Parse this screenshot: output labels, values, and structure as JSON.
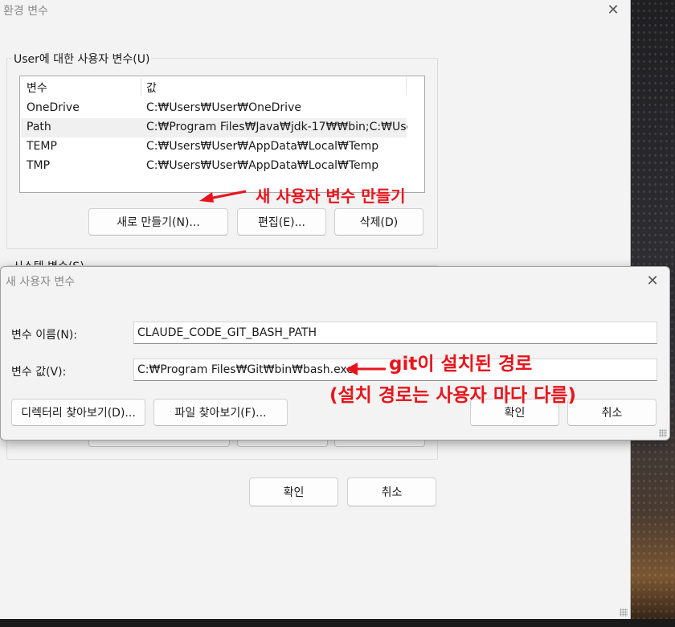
{
  "env_dialog": {
    "title": "환경 변수",
    "user_group_label": "User에 대한 사용자 변수(U)",
    "system_group_label": "시스템 변수(S)",
    "columns": [
      "변수",
      "값"
    ],
    "rows": [
      {
        "name": "OneDrive",
        "value": "C:₩Users₩User₩OneDrive"
      },
      {
        "name": "Path",
        "value": "C:₩Program Files₩Java₩jdk-17₩₩bin;C:₩Use..."
      },
      {
        "name": "TEMP",
        "value": "C:₩Users₩User₩AppData₩Local₩Temp"
      },
      {
        "name": "TMP",
        "value": "C:₩Users₩User₩AppData₩Local₩Temp"
      }
    ],
    "selected_row": 1,
    "buttons": {
      "new": "새로 만들기(N)...",
      "edit": "편집(E)...",
      "delete": "삭제(D)"
    },
    "footer_buttons": {
      "ok": "확인",
      "cancel": "취소"
    }
  },
  "new_var_dialog": {
    "title": "새 사용자 변수",
    "name_label": "변수 이름(N):",
    "name_value": "CLAUDE_CODE_GIT_BASH_PATH",
    "value_label": "변수 값(V):",
    "value_value": "C:₩Program Files₩Git₩bin₩bash.exe",
    "buttons": {
      "browse_dir": "디렉터리 찾아보기(D)...",
      "browse_file": "파일 찾아보기(F)...",
      "ok": "확인",
      "cancel": "취소"
    }
  },
  "annotations": {
    "new_var": "새 사용자 변수 만들기",
    "git_path_line1": "git이 설치된 경로",
    "git_path_line2": "(설치 경로는 사용자 마다 다름)",
    "color": "#e8141c"
  },
  "icons": {
    "close": "close-icon",
    "resize": "resize-grip-icon"
  }
}
